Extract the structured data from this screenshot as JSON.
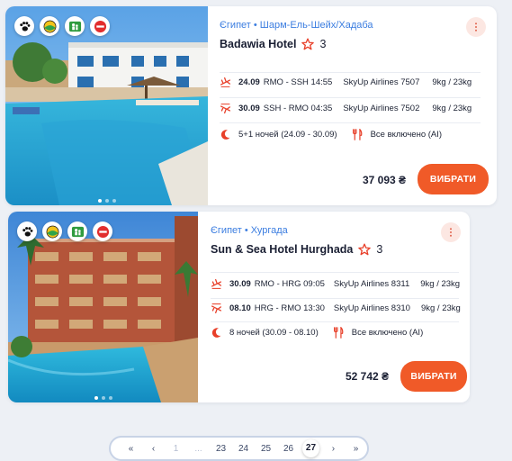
{
  "offers": [
    {
      "location": "Єгипет • Шарм-Ель-Шейх/Хадаба",
      "hotel": "Badawia Hotel",
      "stars": "3",
      "flights": [
        {
          "date": "24.09",
          "route": "RMO - SSH 14:55",
          "airline": "SkyUp Airlines 7507",
          "baggage": "9kg / 23kg"
        },
        {
          "date": "30.09",
          "route": "SSH - RMO 04:35",
          "airline": "SkyUp Airlines 7502",
          "baggage": "9kg / 23kg"
        }
      ],
      "nights": "5+1 ночей (24.09 - 30.09)",
      "meals": "Все включено (AI)",
      "price": "37 093 ₴",
      "button": "ВИБРАТИ"
    },
    {
      "location": "Єгипет • Хургада",
      "hotel": "Sun & Sea Hotel Hurghada",
      "stars": "3",
      "flights": [
        {
          "date": "30.09",
          "route": "RMO - HRG 09:05",
          "airline": "SkyUp Airlines 8311",
          "baggage": "9kg / 23kg"
        },
        {
          "date": "08.10",
          "route": "HRG - RMO 13:30",
          "airline": "SkyUp Airlines 8310",
          "baggage": "9kg / 23kg"
        }
      ],
      "nights": "8 ночей (30.09 - 08.10)",
      "meals": "Все включено (AI)",
      "price": "52 742 ₴",
      "button": "ВИБРАТИ"
    }
  ],
  "pagination": {
    "first": "«",
    "prev": "‹",
    "p1": "1",
    "ellipsis": "...",
    "p23": "23",
    "p24": "24",
    "p25": "25",
    "p26": "26",
    "p27": "27",
    "next": "›",
    "last": "»"
  },
  "colors": {
    "accent": "#f05a28",
    "link": "#3b7de0"
  }
}
